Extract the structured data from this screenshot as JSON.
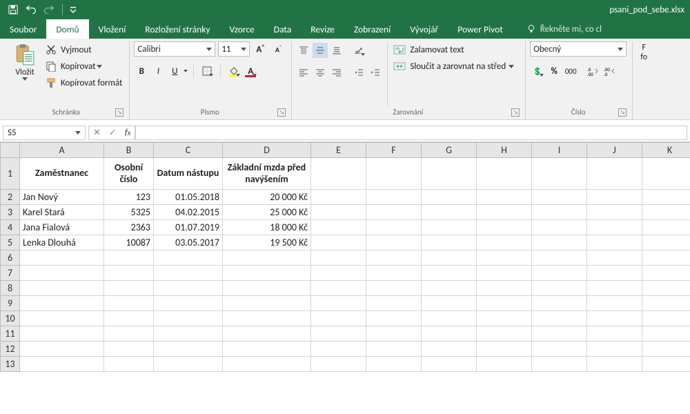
{
  "window": {
    "document_title": "psani_pod_sebe.xlsx"
  },
  "qat": {
    "save": "Uložit",
    "undo": "Zpět",
    "redo": "Znovu"
  },
  "tabs": {
    "file": "Soubor",
    "home": "Domů",
    "insert": "Vložení",
    "pageLayout": "Rozložení stránky",
    "formulas": "Vzorce",
    "data": "Data",
    "review": "Revize",
    "view": "Zobrazení",
    "developer": "Vývojář",
    "powerpivot": "Power Pivot",
    "tell_me": "Řekněte mi, co cl"
  },
  "ribbon": {
    "clipboard": {
      "paste": "Vložit",
      "cut": "Vyjmout",
      "copy": "Kopírovat",
      "formatPainter": "Kopírovat formát",
      "label": "Schránka"
    },
    "font": {
      "name": "Calibri",
      "size": "11",
      "label": "Písmo"
    },
    "alignment": {
      "wrap": "Zalamovat text",
      "merge": "Sloučit a zarovnat na střed",
      "label": "Zarovnání"
    },
    "number": {
      "format": "Obecný",
      "label": "Číslo"
    },
    "format_right": "fo"
  },
  "namebox": {
    "value": "S5"
  },
  "formula": {
    "value": ""
  },
  "sheet": {
    "columns": [
      "A",
      "B",
      "C",
      "D",
      "E",
      "F",
      "G",
      "H",
      "I",
      "J",
      "K"
    ],
    "header_row": 1,
    "headers": {
      "A": "Zaměstnanec",
      "B": "Osobní číslo",
      "C": "Datum nástupu",
      "D": "Základní mzda před navýšením"
    },
    "rows": [
      {
        "r": 2,
        "A": "Jan Nový",
        "B": "123",
        "C": "01.05.2018",
        "D": "20 000 Kč"
      },
      {
        "r": 3,
        "A": "Karel Stará",
        "B": "5325",
        "C": "04.02.2015",
        "D": "25 000 Kč"
      },
      {
        "r": 4,
        "A": "Jana Fialová",
        "B": "2363",
        "C": "01.07.2019",
        "D": "18 000 Kč"
      },
      {
        "r": 5,
        "A": "Lenka Dlouhá",
        "B": "10087",
        "C": "03.05.2017",
        "D": "19 500 Kč"
      }
    ],
    "empty_rows": [
      6,
      7,
      8,
      9,
      10,
      11,
      12,
      13
    ],
    "selection": {
      "cell": "S5"
    }
  }
}
